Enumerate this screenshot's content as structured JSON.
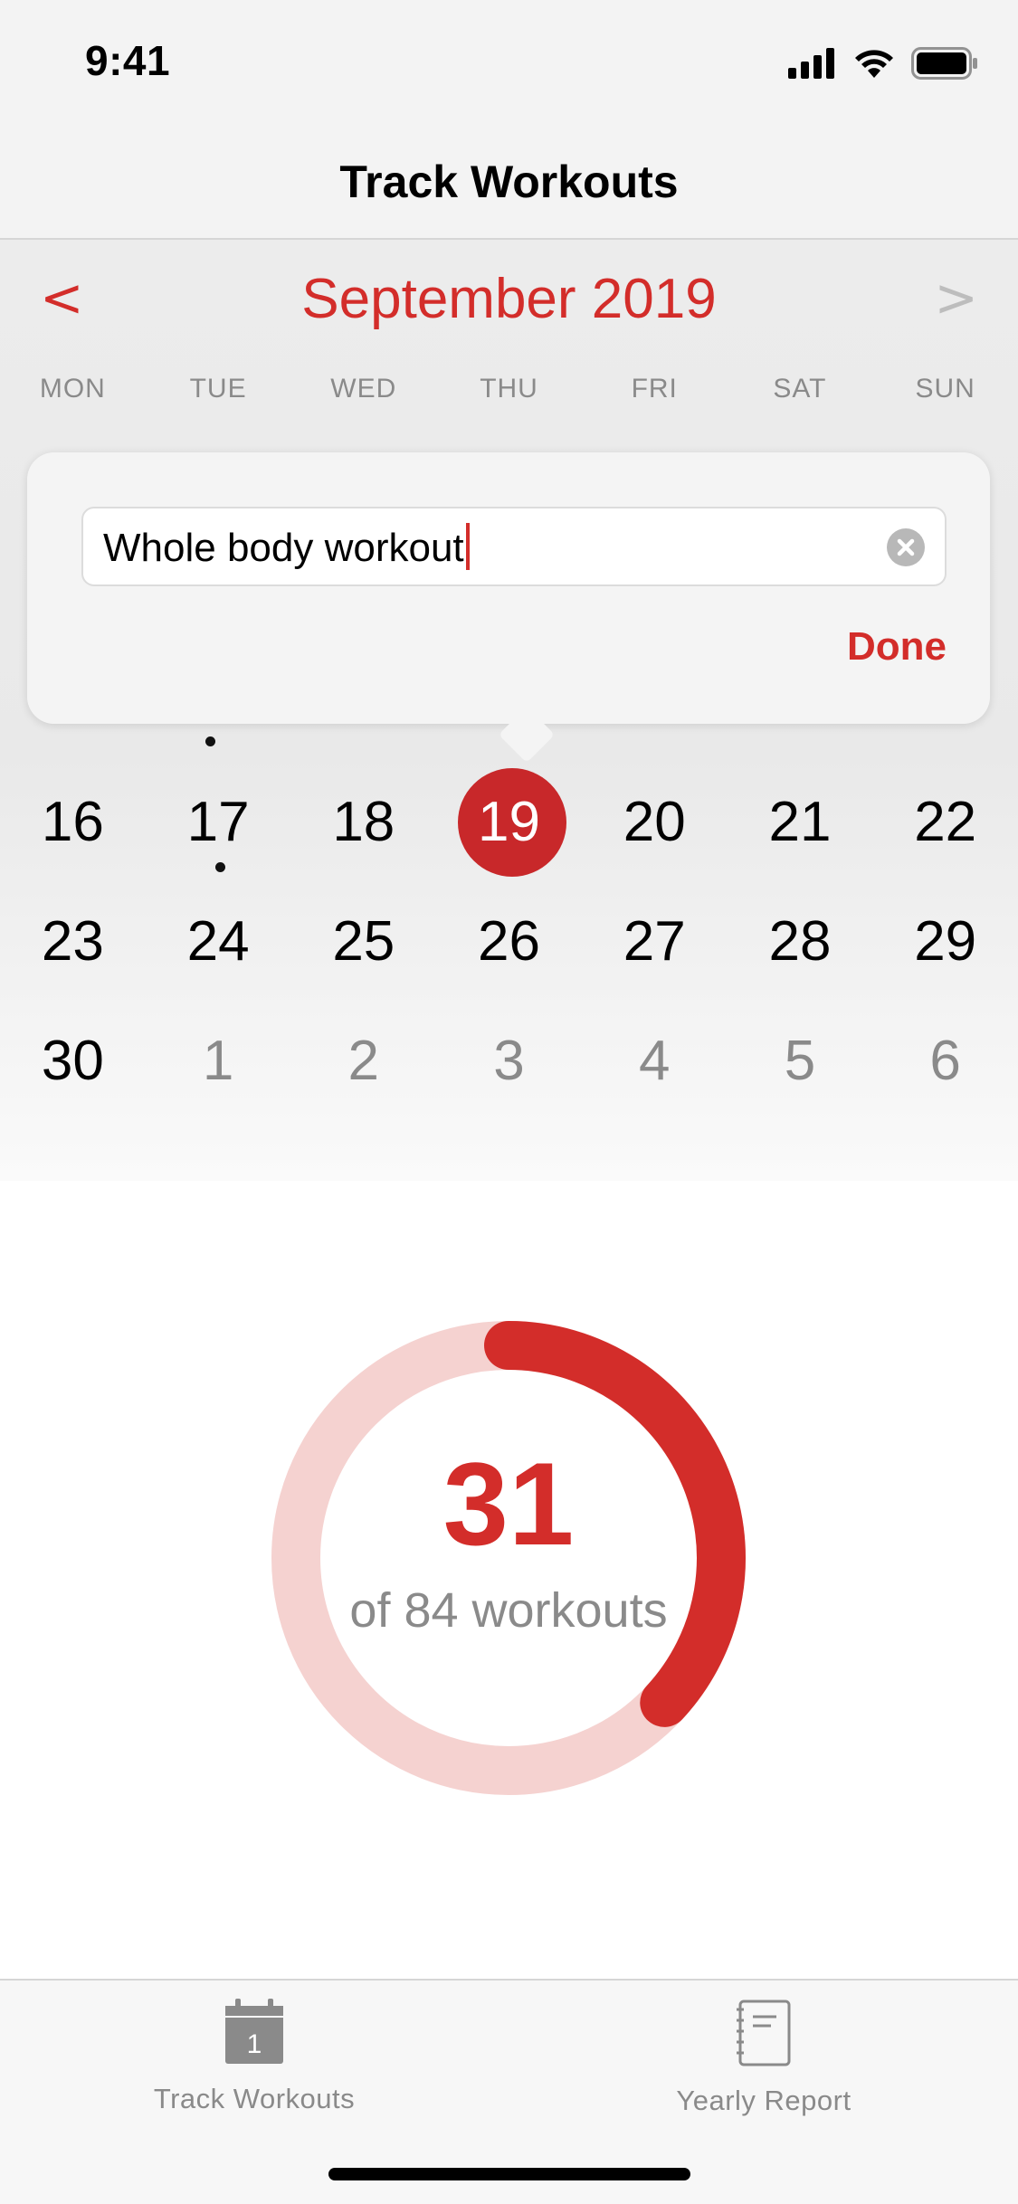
{
  "status_bar": {
    "time": "9:41"
  },
  "nav": {
    "title": "Track Workouts"
  },
  "calendar": {
    "prev_label": "<",
    "next_label": ">",
    "month_title": "September 2019",
    "weekdays": [
      "MON",
      "TUE",
      "WED",
      "THU",
      "FRI",
      "SAT",
      "SUN"
    ],
    "rows": [
      [
        "16",
        "17",
        "18",
        "19",
        "20",
        "21",
        "22"
      ],
      [
        "23",
        "24",
        "25",
        "26",
        "27",
        "28",
        "29"
      ],
      [
        "30",
        "1",
        "2",
        "3",
        "4",
        "5",
        "6"
      ]
    ],
    "selected_day": "19"
  },
  "popover": {
    "input_value": "Whole body workout",
    "done_label": "Done"
  },
  "progress": {
    "count": "31",
    "label": "of 84 workouts",
    "completed": 31,
    "total": 84,
    "accent": "#d32d2a",
    "track": "#f5d2d0"
  },
  "tab_bar": {
    "tabs": [
      {
        "label": "Track Workouts",
        "icon": "calendar-icon",
        "badge": "1"
      },
      {
        "label": "Yearly Report",
        "icon": "notebook-icon"
      }
    ]
  }
}
